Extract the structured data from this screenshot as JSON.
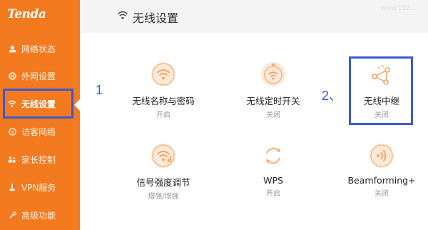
{
  "app": {
    "logo_text": "Tenda",
    "watermark": "www.192..."
  },
  "sidebar": {
    "items": [
      {
        "label": "网络状态",
        "icon": "status-icon"
      },
      {
        "label": "外网设置",
        "icon": "globe-icon"
      },
      {
        "label": "无线设置",
        "icon": "wifi-icon",
        "active": true
      },
      {
        "label": "访客网络",
        "icon": "guest-icon"
      },
      {
        "label": "家长控制",
        "icon": "parental-icon"
      },
      {
        "label": "VPN服务",
        "icon": "vpn-icon"
      },
      {
        "label": "高级功能",
        "icon": "advanced-icon"
      }
    ]
  },
  "header": {
    "title": "无线设置",
    "icon": "wifi-icon"
  },
  "annotations": {
    "step1": "1",
    "step2": "2、"
  },
  "tiles": [
    {
      "label": "无线名称与密码",
      "status": "开启",
      "icon": "wifi-icon"
    },
    {
      "label": "无线定时开关",
      "status": "关闭",
      "icon": "wifi-timer-icon"
    },
    {
      "label": "无线中继",
      "status": "关闭",
      "icon": "repeater-icon"
    },
    {
      "label": "信号强度调节",
      "status": "增强/增强",
      "icon": "signal-strength-icon"
    },
    {
      "label": "WPS",
      "status": "开启",
      "icon": "wps-icon"
    },
    {
      "label": "Beamforming+",
      "status": "关闭",
      "icon": "beamforming-icon"
    }
  ],
  "colors": {
    "brand": "#f47a20",
    "highlight": "#3a59d6",
    "icon": "#f7b07a",
    "icon_bg": "#fde9d8"
  }
}
